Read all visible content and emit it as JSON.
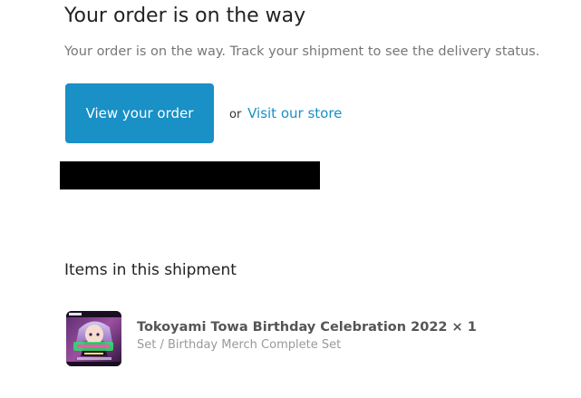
{
  "header": {
    "title": "Your order is on the way",
    "subtitle": "Your order is on the way. Track your shipment to see the delivery status."
  },
  "actions": {
    "primary_button_label": "View your order",
    "or_text": "or",
    "secondary_link_label": "Visit our store"
  },
  "colors": {
    "accent": "#1990c6",
    "redaction": "#000000"
  },
  "shipment": {
    "heading": "Items in this shipment",
    "items": [
      {
        "title": "Tokoyami Towa Birthday Celebration 2022 × 1",
        "variant": "Set / Birthday Merch Complete Set",
        "thumbnail_icon": "product-thumbnail-image"
      }
    ]
  }
}
